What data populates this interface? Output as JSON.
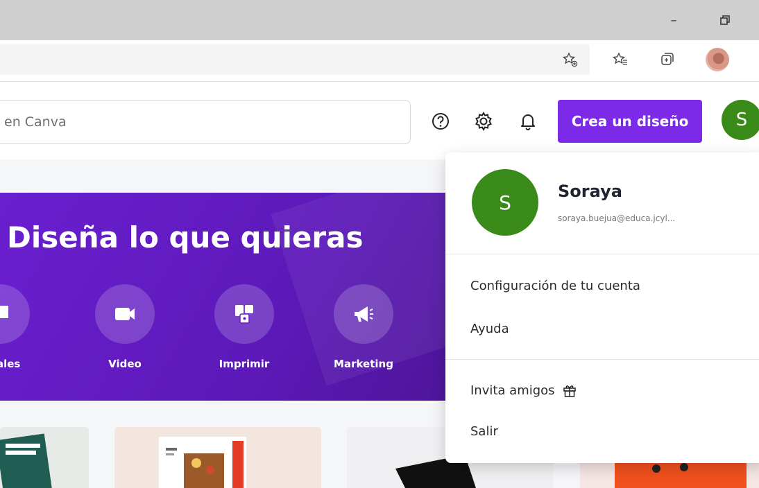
{
  "browser": {
    "window_controls": {
      "minimize": "–",
      "restore": "⧉"
    }
  },
  "canva": {
    "search": {
      "placeholder": "en Canva"
    },
    "create_button": "Crea un diseño",
    "avatar_initial": "S",
    "brand_color": "#7d2ae8",
    "avatar_color": "#3a8a19"
  },
  "hero": {
    "title": "Diseña lo que quieras",
    "categories": [
      {
        "label": "ociales",
        "icon": "chat-bubble-icon"
      },
      {
        "label": "Video",
        "icon": "video-camera-icon"
      },
      {
        "label": "Imprimir",
        "icon": "print-icon"
      },
      {
        "label": "Marketing",
        "icon": "megaphone-icon"
      }
    ]
  },
  "account_menu": {
    "initial": "S",
    "name": "Soraya",
    "email": "soraya.buejua@educa.jcyl...",
    "items": [
      {
        "label": "Configuración de tu cuenta"
      },
      {
        "label": "Ayuda"
      },
      {
        "label": "Invita amigos",
        "icon": "gift-icon"
      },
      {
        "label": "Salir"
      }
    ]
  }
}
